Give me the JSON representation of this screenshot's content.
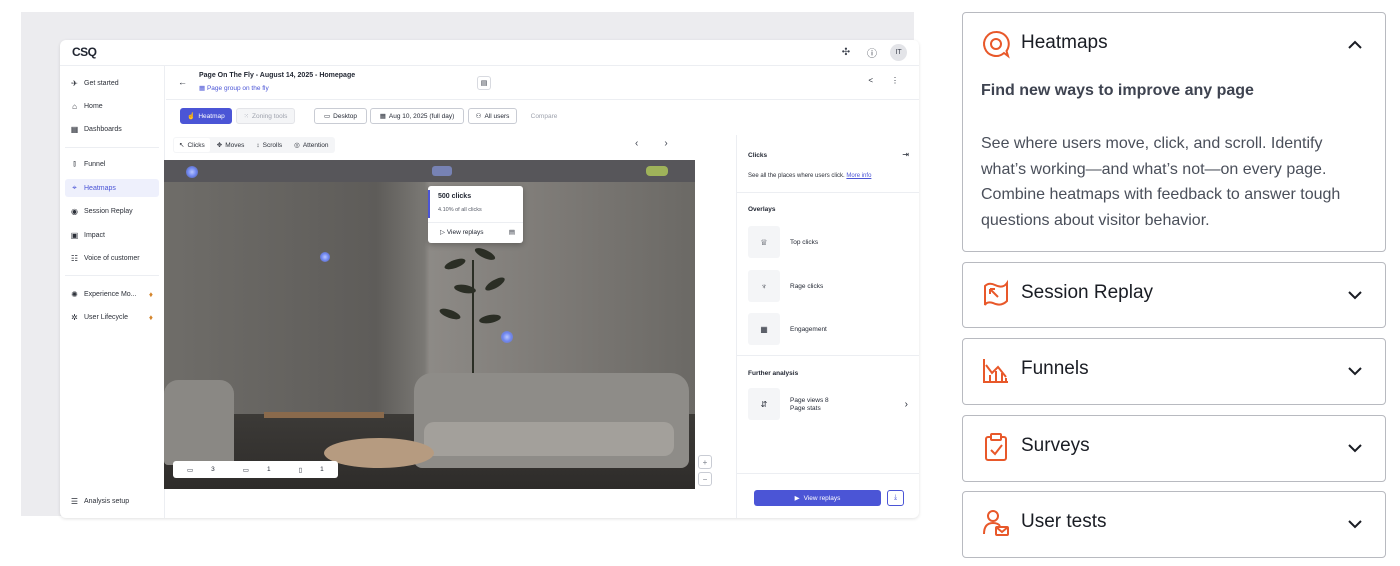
{
  "app": {
    "logo": "CSQ",
    "avatar_initials": "IT",
    "top_icons": [
      "puzzle-icon",
      "help-icon"
    ]
  },
  "sidebar": {
    "items": [
      {
        "label": "Get started",
        "icon": "rocket-icon"
      },
      {
        "label": "Home",
        "icon": "home-icon"
      },
      {
        "label": "Dashboards",
        "icon": "dashboard-icon"
      },
      {
        "label": "Funnel",
        "icon": "funnel-icon"
      },
      {
        "label": "Heatmaps",
        "icon": "heatmap-icon",
        "active": true
      },
      {
        "label": "Session Replay",
        "icon": "play-icon"
      },
      {
        "label": "Impact",
        "icon": "impact-icon"
      },
      {
        "label": "Voice of customer",
        "icon": "voice-icon"
      },
      {
        "label": "Experience Mo...",
        "icon": "experience-icon"
      },
      {
        "label": "User Lifecycle",
        "icon": "lifecycle-icon"
      }
    ],
    "footer_label": "Analysis setup"
  },
  "header": {
    "title": "Page On The Fly - August 14, 2025 - Homepage",
    "subtitle": "Page group on the fly"
  },
  "toolbar": {
    "heatmap": "Heatmap",
    "zoning": "Zoning tools",
    "device": "Desktop",
    "date": "Aug 10, 2025 (full day)",
    "users": "All users",
    "compare": "Compare"
  },
  "view_tabs": [
    "Clicks",
    "Moves",
    "Scrolls",
    "Attention"
  ],
  "device_counts": {
    "desktop": "3",
    "tablet": "1",
    "mobile": "1"
  },
  "tooltip": {
    "clicks": "500 clicks",
    "share": "4.10% of all clicks",
    "action": "View replays"
  },
  "right_panel": {
    "title": "Clicks",
    "description": "See all the places where users click.",
    "more_info": "More info",
    "overlays_heading": "Overlays",
    "overlays": [
      "Top clicks",
      "Rage clicks",
      "Engagement"
    ],
    "further_heading": "Further analysis",
    "further_line1": "Page views 8",
    "further_line2": "Page stats",
    "view_replays": "View replays"
  },
  "accordion": {
    "accent": "#e8582a",
    "sections": [
      {
        "title": "Heatmaps",
        "expanded": true,
        "icon": "heatmap-icon",
        "subtitle": "Find new ways to improve any page",
        "body": "See where users move, click, and scroll. Identify what’s working—and what’s not—on every page. Combine heatmaps with feedback to answer tough questions about visitor behavior."
      },
      {
        "title": "Session Replay",
        "expanded": false,
        "icon": "session-replay-icon"
      },
      {
        "title": "Funnels",
        "expanded": false,
        "icon": "funnels-icon"
      },
      {
        "title": "Surveys",
        "expanded": false,
        "icon": "surveys-icon"
      },
      {
        "title": "User tests",
        "expanded": false,
        "icon": "user-tests-icon"
      }
    ]
  }
}
